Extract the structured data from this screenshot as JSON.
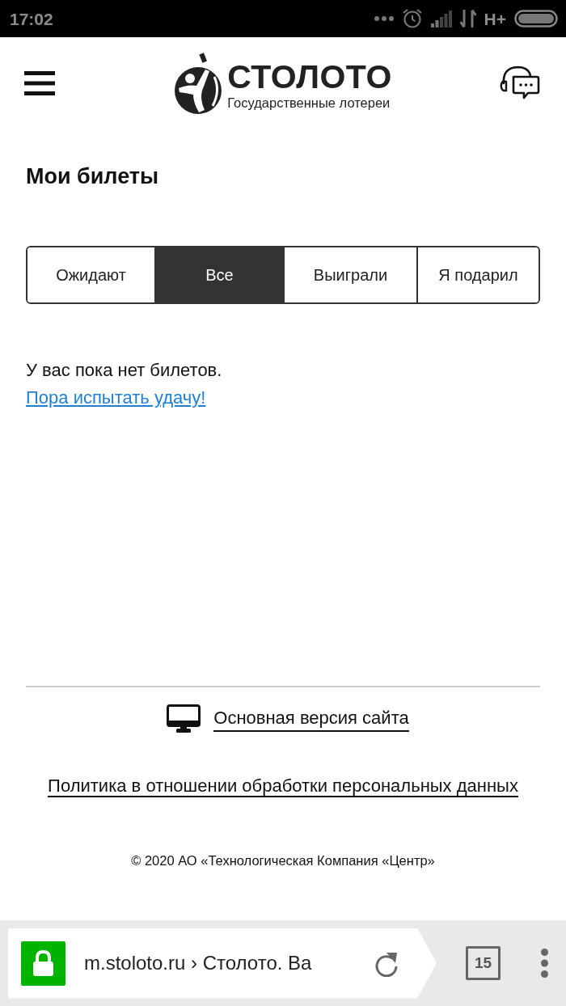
{
  "status_bar": {
    "time": "17:02",
    "network_type": "H+"
  },
  "header": {
    "brand_name": "СТОЛОТО",
    "brand_tagline": "Государственные лотереи"
  },
  "page": {
    "title": "Мои билеты",
    "tabs": [
      {
        "label": "Ожидают",
        "selected": false
      },
      {
        "label": "Все",
        "selected": true
      },
      {
        "label": "Выиграли",
        "selected": false
      },
      {
        "label": "Я подарил",
        "selected": false
      }
    ],
    "empty_message": "У вас пока нет билетов.",
    "cta_link": "Пора испытать удачу!"
  },
  "footer": {
    "desktop_link": "Основная версия сайта",
    "policy_link": "Политика в отношении обработки персональных данных",
    "copyright": "© 2020 АО «Технологическая Компания «Центр»"
  },
  "browser_bar": {
    "address": "m.stoloto.ru › Столото. Ва",
    "tab_count": "15"
  }
}
